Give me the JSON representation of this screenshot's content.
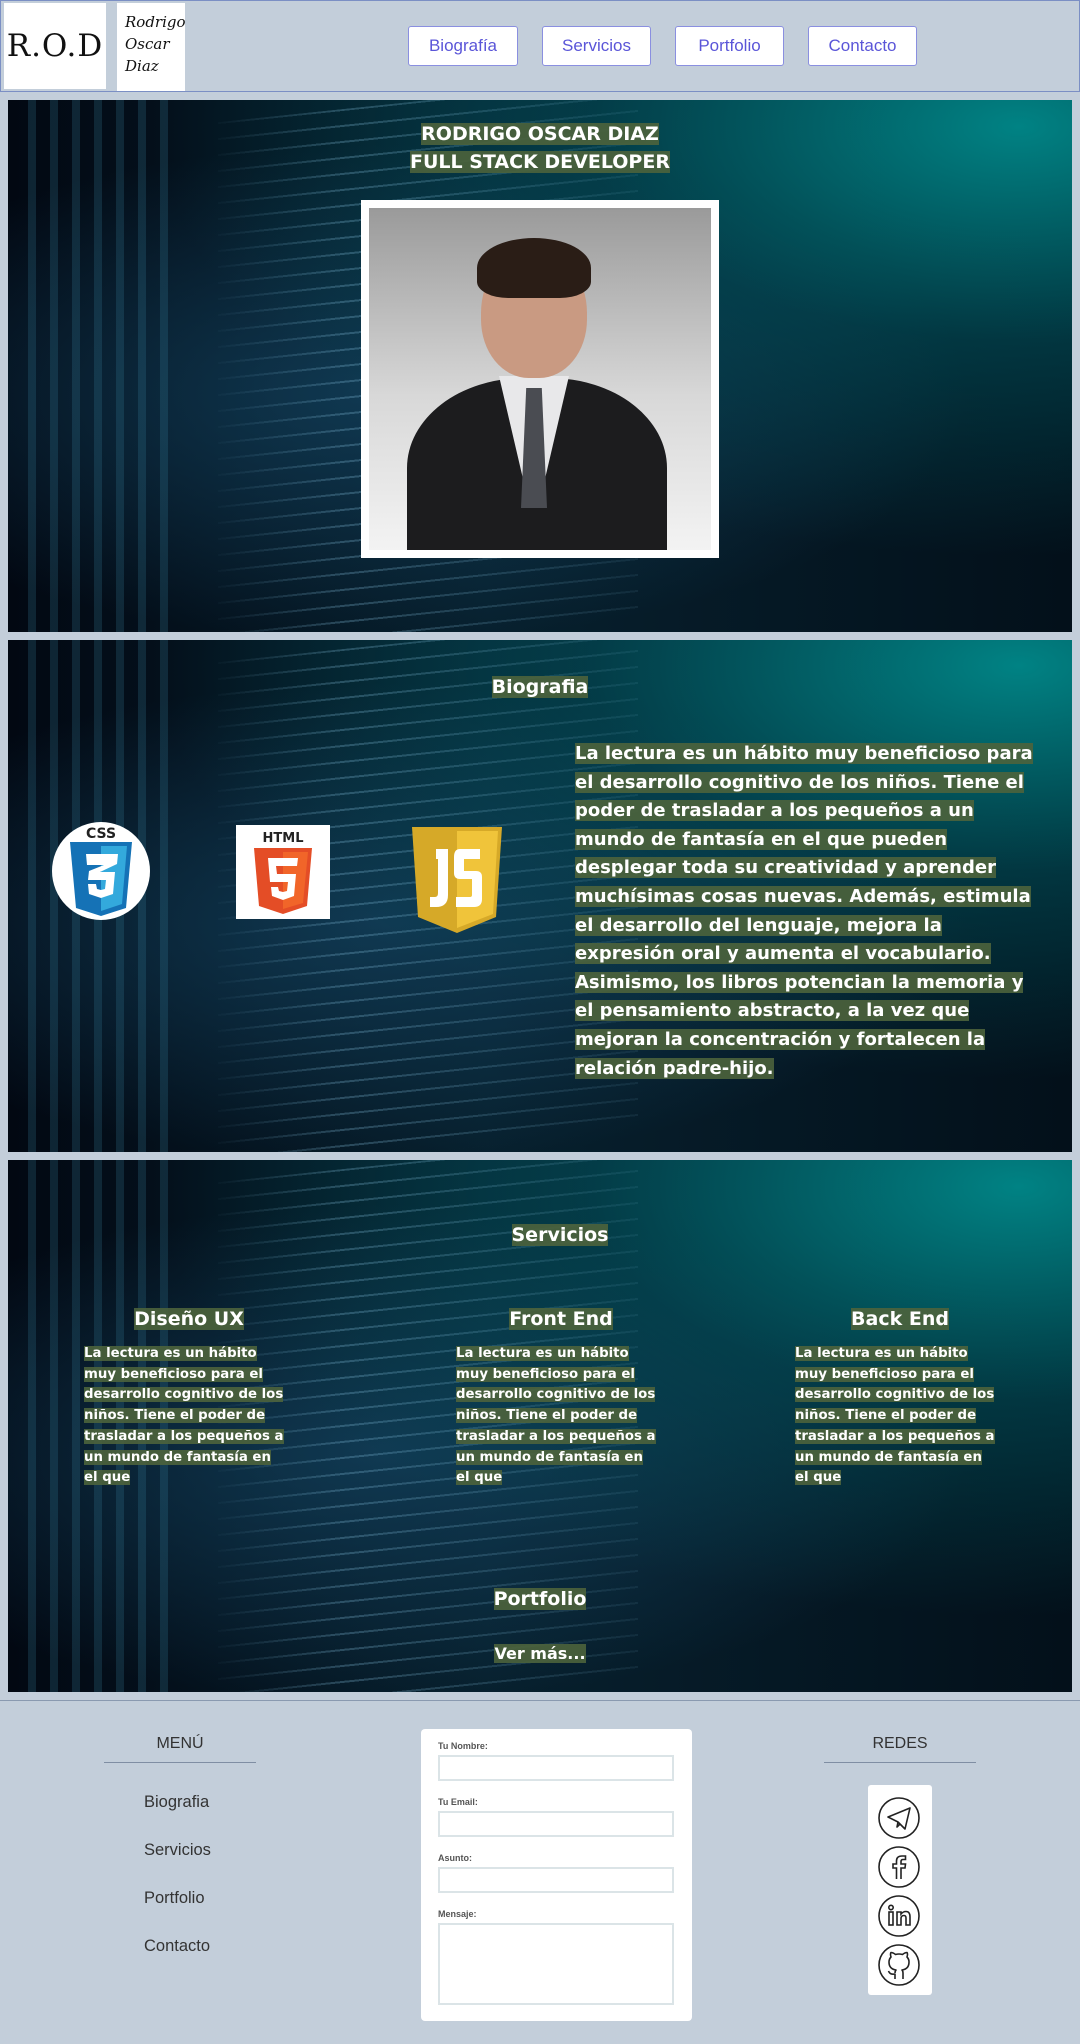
{
  "header": {
    "logo_text": "R.O.D",
    "logo_signature": [
      "Rodrigo",
      "Oscar",
      "Diaz"
    ],
    "nav": [
      "Biografía",
      "Servicios",
      "Portfolio",
      "Contacto"
    ]
  },
  "hero": {
    "name": "RODRIGO OSCAR DIAZ",
    "role": "FULL STACK DEVELOPER"
  },
  "bio": {
    "title": "Biografia",
    "text": "La lectura es un hábito muy beneficioso para el desarrollo cognitivo de los niños. Tiene el poder de trasladar a los pequeños a un mundo de fantasía en el que pueden desplegar toda su creatividad y aprender muchísimas cosas nuevas. Además, estimula el desarrollo del lenguaje, mejora la expresión oral y aumenta el vocabulario. Asimismo, los libros potencian la memoria y el pensamiento abstracto, a la vez que mejoran la concentración y fortalecen la relación padre-hijo.",
    "icons": [
      "css3-icon",
      "html5-icon",
      "javascript-icon"
    ],
    "icon_labels": {
      "css": "CSS",
      "html": "HTML"
    }
  },
  "services": {
    "title": "Servicios",
    "items": [
      {
        "title": "Diseño UX",
        "text": "La lectura es un hábito muy beneficioso para el desarrollo cognitivo de los niños. Tiene el poder de trasladar a los pequeños a un mundo de fantasía en el que"
      },
      {
        "title": "Front End",
        "text": "La lectura es un hábito muy beneficioso para el desarrollo cognitivo de los niños. Tiene el poder de trasladar a los pequeños a un mundo de fantasía en el que"
      },
      {
        "title": "Back End",
        "text": "La lectura es un hábito muy beneficioso para el desarrollo cognitivo de los niños. Tiene el poder de trasladar a los pequeños a un mundo de fantasía en el que"
      }
    ]
  },
  "portfolio": {
    "title": "Portfolio",
    "more": "Ver más..."
  },
  "footer": {
    "menu_title": "MENÚ",
    "menu_items": [
      "Biografia",
      "Servicios",
      "Portfolio",
      "Contacto"
    ],
    "form": {
      "name_label": "Tu Nombre:",
      "email_label": "Tu Email:",
      "subject_label": "Asunto:",
      "message_label": "Mensaje:"
    },
    "social_title": "REDES",
    "social_icons": [
      "telegram-icon",
      "facebook-icon",
      "linkedin-icon",
      "github-icon"
    ]
  },
  "colors": {
    "text_highlight": "#4d633c",
    "nav_text": "#5a55d8",
    "page_bg": "#c3ceda"
  }
}
